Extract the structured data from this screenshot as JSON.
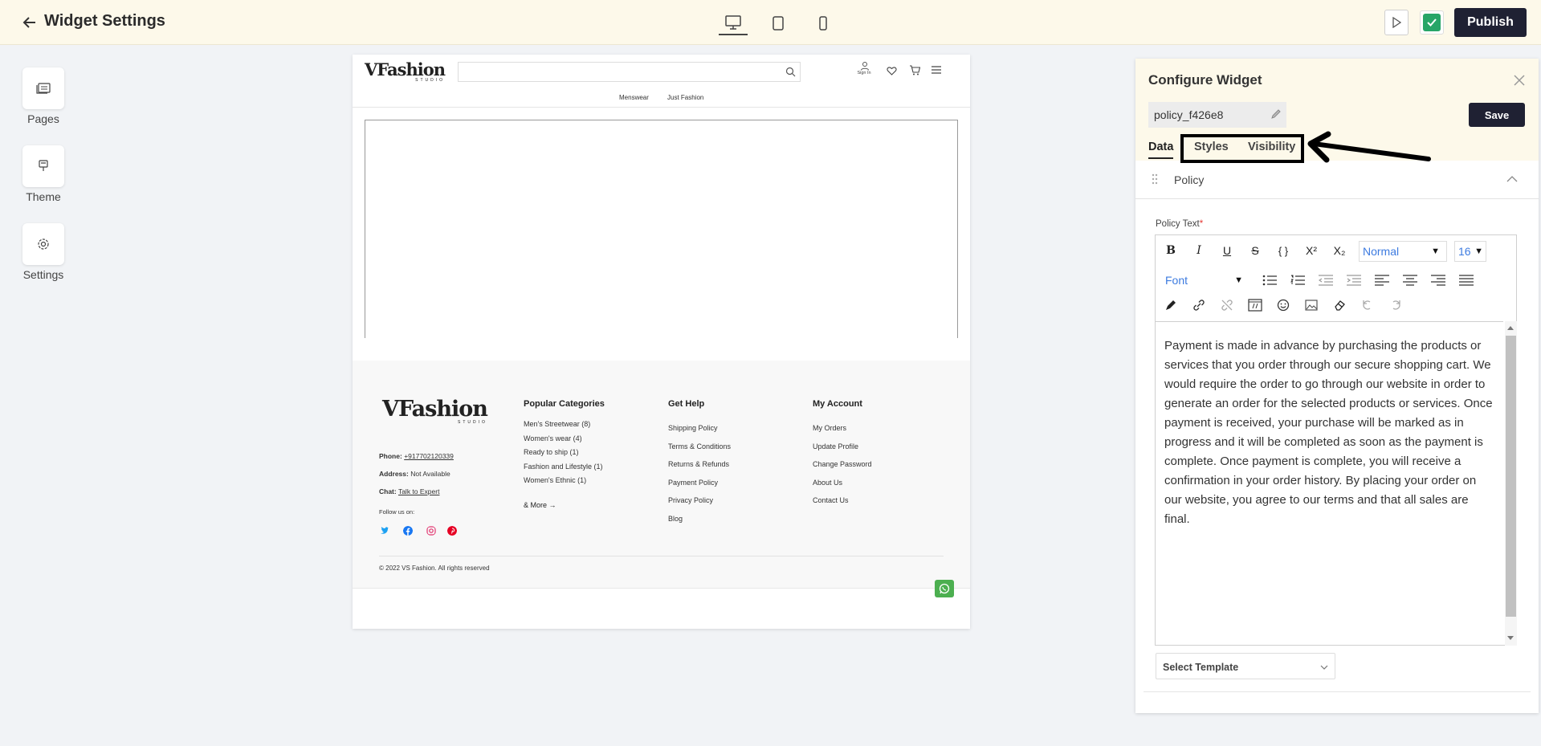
{
  "header": {
    "back_icon": "arrow-left-icon",
    "title": "Widget Settings",
    "devices": [
      "desktop",
      "tablet",
      "mobile"
    ],
    "publish_label": "Publish"
  },
  "sidebar": {
    "items": [
      {
        "label": "Pages",
        "icon": "pages-icon"
      },
      {
        "label": "Theme",
        "icon": "theme-icon"
      },
      {
        "label": "Settings",
        "icon": "gear-icon"
      }
    ]
  },
  "preview": {
    "logo": "VFashion",
    "logo_sub": "STUDIO",
    "sign_in": "Sign In",
    "nav": [
      "Menswear",
      "Just Fashion"
    ],
    "footer": {
      "phone_label": "Phone:",
      "phone": "+917702120339",
      "address_label": "Address:",
      "address": "Not Available",
      "chat_label": "Chat:",
      "chat": "Talk to Expert",
      "follow": "Follow us on:",
      "col1_title": "Popular Categories",
      "col1": [
        "Men's Streetwear (8)",
        "Women's wear (4)",
        "Ready to ship (1)",
        "Fashion and Lifestyle (1)",
        "Women's Ethnic (1)"
      ],
      "more": "& More →",
      "col2_title": "Get Help",
      "col2": [
        "Shipping Policy",
        "Terms & Conditions",
        "Returns & Refunds",
        "Payment Policy",
        "Privacy Policy",
        "Blog"
      ],
      "col3_title": "My Account",
      "col3": [
        "My Orders",
        "Update Profile",
        "Change Password",
        "About Us",
        "Contact Us"
      ],
      "copyright": "© 2022 VS Fashion. All rights reserved"
    }
  },
  "panel": {
    "title": "Configure Widget",
    "widget_name": "policy_f426e8",
    "save_label": "Save",
    "tabs": [
      "Data",
      "Styles",
      "Visibility"
    ],
    "section": "Policy",
    "field_label": "Policy Text",
    "format_select": "Normal",
    "size_select": "16",
    "font_select": "Font",
    "content": "Payment is made in advance by purchasing the products or services that you order through our secure shopping cart. We would require the order to go through our website in order to generate an order for the selected products or services.        Once payment is received, your purchase will be marked as in progress and it will be completed as soon as the payment is complete. Once payment is complete, you will receive a confirmation in your order history.        By placing your order on our website, you agree to our terms and that all sales are final.",
    "template_placeholder": "Select Template"
  },
  "colors": {
    "accent_dark": "#1f2133",
    "publish_green": "#27a567",
    "header_bg": "#fdf9ea",
    "whatsapp": "#4caf50"
  }
}
